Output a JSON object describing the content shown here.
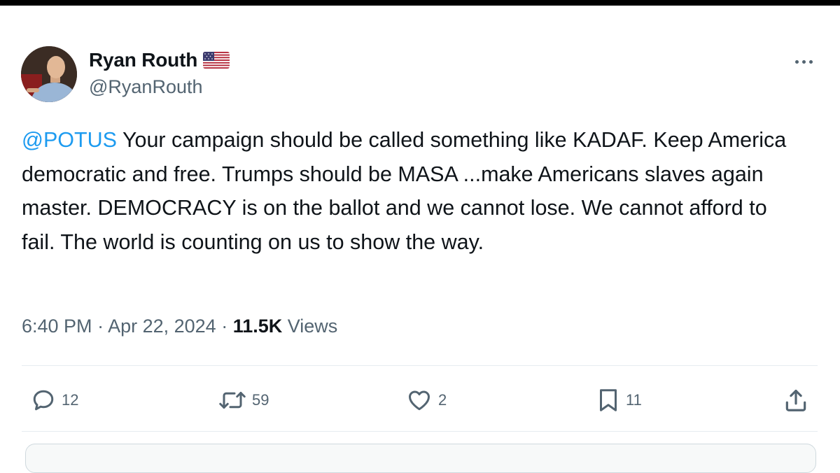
{
  "author": {
    "display_name": "Ryan Routh",
    "handle": "@RyanRouth",
    "flag_icon": "us-flag-icon"
  },
  "tweet": {
    "mention": "@POTUS",
    "text": " Your campaign should be called something like KADAF. Keep America democratic and free. Trumps should be MASA ...make Americans slaves again master. DEMOCRACY is on the ballot and we cannot lose. We cannot afford to fail. The world is counting on us to show the way."
  },
  "meta": {
    "time": "6:40 PM",
    "separator": " · ",
    "date": "Apr 22, 2024",
    "views_count": "11.5K",
    "views_label": " Views"
  },
  "actions": {
    "replies": "12",
    "reposts": "59",
    "likes": "2",
    "bookmarks": "11"
  },
  "colors": {
    "accent": "#1d9bf0",
    "secondary_text": "#536471",
    "primary_text": "#0f1419"
  }
}
